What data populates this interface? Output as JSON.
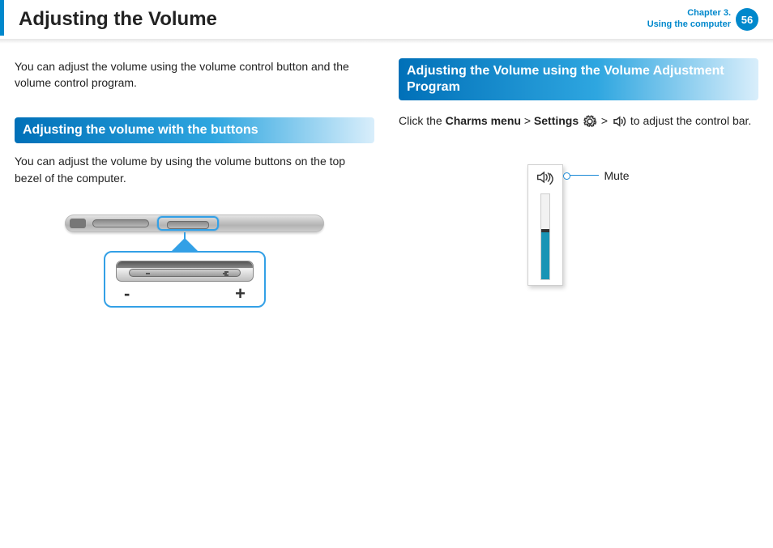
{
  "header": {
    "title": "Adjusting the Volume",
    "chapter_line1": "Chapter 3.",
    "chapter_line2": "Using the computer",
    "page_number": "56"
  },
  "left": {
    "intro": "You can adjust the volume using the volume control button and the volume control program.",
    "section_title": "Adjusting the volume with the buttons",
    "section_text": "You can adjust the volume by using the volume buttons on the top bezel of the computer.",
    "minus": "-",
    "plus": "+"
  },
  "right": {
    "section_title": "Adjusting the Volume using the Volume Adjustment Program",
    "instr_prefix": "Click the ",
    "instr_charms": "Charms menu",
    "instr_sep1": " > ",
    "instr_settings": "Settings",
    "instr_sep2": " > ",
    "instr_suffix": " to adjust the control bar.",
    "mute_label": "Mute"
  }
}
